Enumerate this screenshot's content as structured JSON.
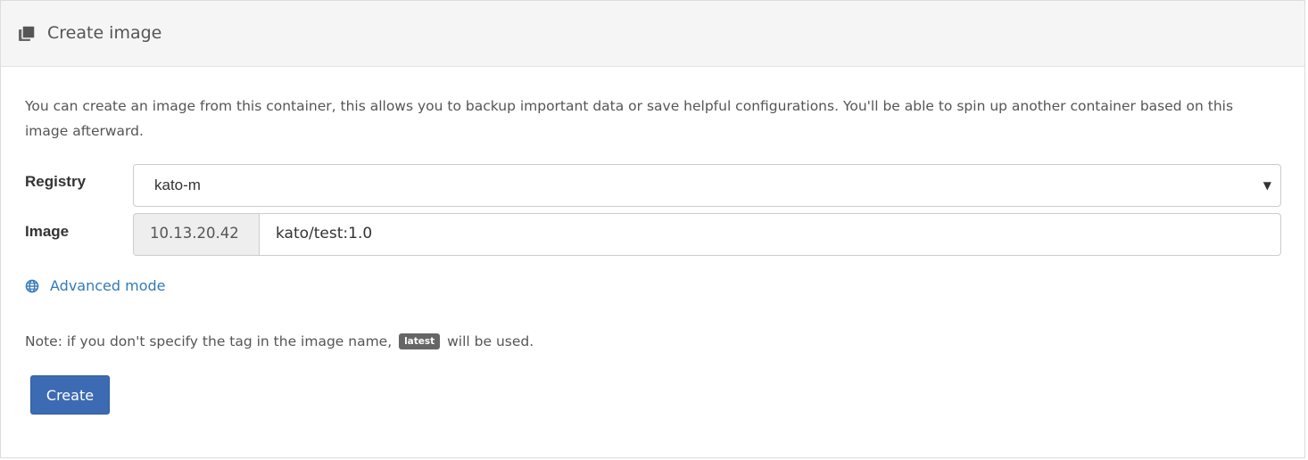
{
  "header": {
    "icon": "images-icon",
    "title": "Create image"
  },
  "description": "You can create an image from this container, this allows you to backup important data or save helpful configurations. You'll be able to spin up another container based on this image afterward.",
  "form": {
    "registry": {
      "label": "Registry",
      "value": "kato-m"
    },
    "image": {
      "label": "Image",
      "prefix": "10.13.20.42",
      "value": "kato/test:1.0"
    }
  },
  "advanced_mode": {
    "icon": "globe-icon",
    "label": "Advanced mode"
  },
  "note": {
    "before": "Note: if you don't specify the tag in the image name,",
    "badge": "latest",
    "after": "will be used."
  },
  "actions": {
    "create_label": "Create"
  },
  "colors": {
    "link": "#337ab7",
    "primary_button": "#3d6bb3",
    "header_bg": "#f5f5f5",
    "addon_bg": "#eeeeee"
  }
}
